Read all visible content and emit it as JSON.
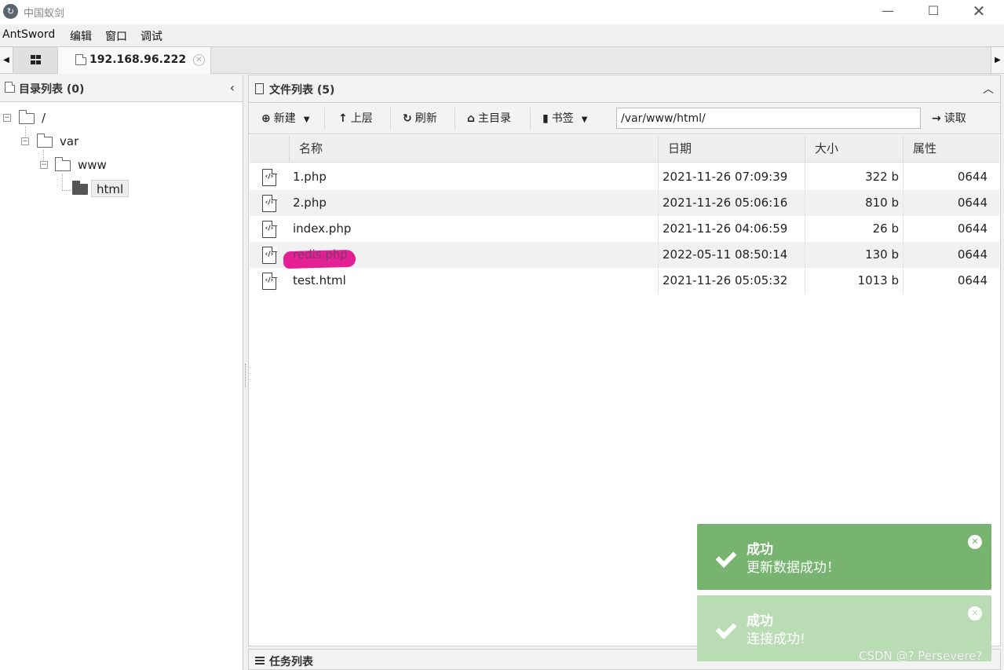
{
  "window": {
    "title": "中国蚁剑",
    "logo": "antsword-logo"
  },
  "menu": [
    {
      "label": "AntSword"
    },
    {
      "label": "编辑"
    },
    {
      "label": "窗口"
    },
    {
      "label": "调试"
    }
  ],
  "tabs": {
    "host_label": "192.168.96.222"
  },
  "left_panel": {
    "title": "目录列表 (0)",
    "tree": [
      {
        "label": "/",
        "depth": 0
      },
      {
        "label": "var",
        "depth": 1
      },
      {
        "label": "www",
        "depth": 2
      },
      {
        "label": "html",
        "depth": 3,
        "selected": true
      }
    ]
  },
  "right_panel": {
    "title": "文件列表 (5)",
    "toolbar": {
      "new_label": "新建",
      "up_label": "上层",
      "refresh_label": "刷新",
      "home_label": "主目录",
      "bookmark_label": "书签",
      "path_value": "/var/www/html/",
      "read_label": "读取"
    },
    "columns": {
      "name": "名称",
      "date": "日期",
      "size": "大小",
      "attr": "属性"
    },
    "files": [
      {
        "name": "1.php",
        "date": "2021-11-26 07:09:39",
        "size": "322 b",
        "attr": "0644"
      },
      {
        "name": "2.php",
        "date": "2021-11-26 05:06:16",
        "size": "810 b",
        "attr": "0644"
      },
      {
        "name": "index.php",
        "date": "2021-11-26 04:06:59",
        "size": "26 b",
        "attr": "0644"
      },
      {
        "name": "redis.php",
        "date": "2022-05-11 08:50:14",
        "size": "130 b",
        "attr": "0644",
        "highlighted": true
      },
      {
        "name": "test.html",
        "date": "2021-11-26 05:05:32",
        "size": "1013 b",
        "attr": "0644"
      }
    ]
  },
  "task_panel": {
    "title": "任务列表"
  },
  "toasts": [
    {
      "title": "成功",
      "message": "更新数据成功！",
      "color": "#76b46f"
    },
    {
      "title": "成功",
      "message": "连接成功!",
      "color": "#b9dcb4"
    }
  ],
  "watermark": "CSDN @? Persevere?",
  "colors": {
    "highlight": "#e4148f",
    "toast_success": "#76b46f"
  }
}
